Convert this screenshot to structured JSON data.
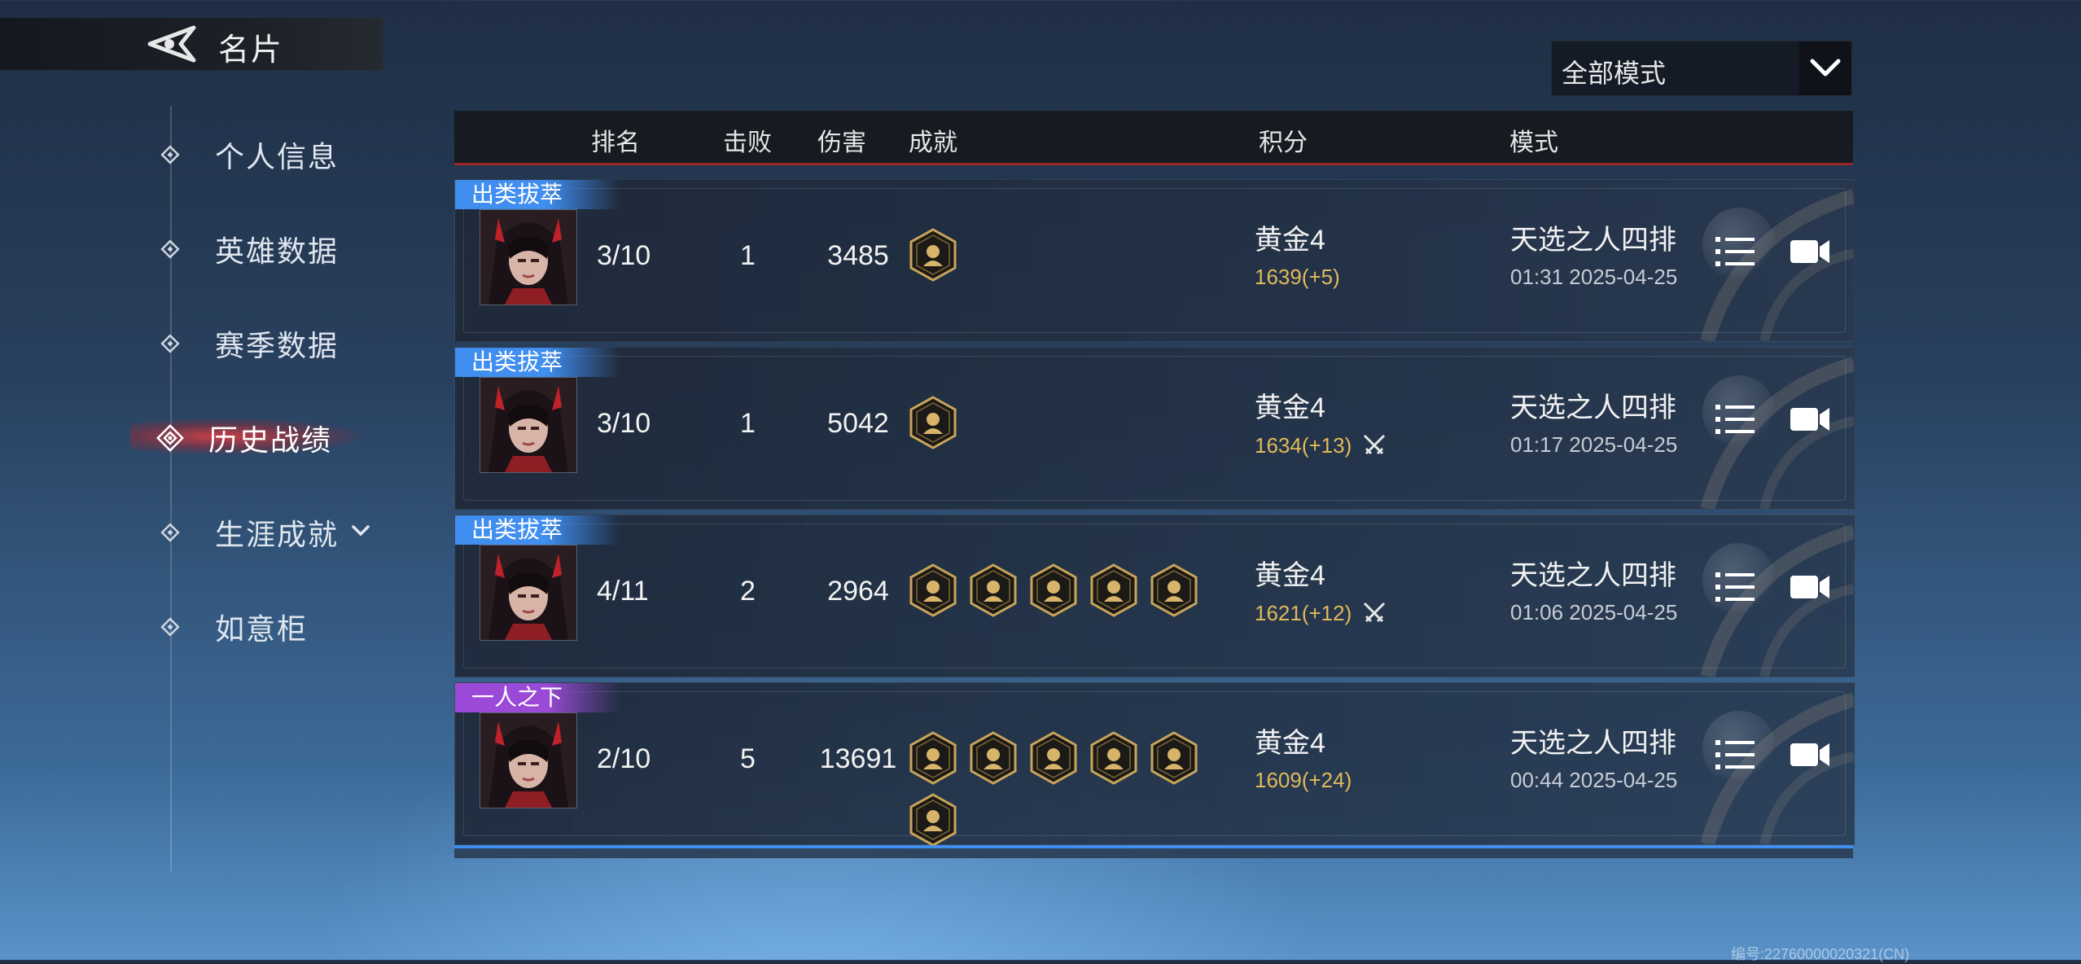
{
  "header": {
    "title": "名片",
    "back_icon": "back-arrow-icon"
  },
  "mode_filter": {
    "selected": "全部模式",
    "icon": "chevron-down-icon"
  },
  "sidebar": {
    "items": [
      {
        "label": "个人信息",
        "active": false
      },
      {
        "label": "英雄数据",
        "active": false
      },
      {
        "label": "赛季数据",
        "active": false
      },
      {
        "label": "历史战绩",
        "active": true
      },
      {
        "label": "生涯成就",
        "active": false,
        "expandable": true
      },
      {
        "label": "如意柜",
        "active": false
      }
    ]
  },
  "table": {
    "columns": [
      "排名",
      "击败",
      "伤害",
      "成就",
      "积分",
      "模式"
    ],
    "rows": [
      {
        "tag": "出类拔萃",
        "tag_color": "#3f8ef0",
        "rank": "3/10",
        "kills": "1",
        "damage": "3485",
        "medals": 1,
        "tier": "黄金4",
        "points": "1639(+5)",
        "swords": false,
        "mode": "天选之人四排",
        "time": "01:31  2025-04-25"
      },
      {
        "tag": "出类拔萃",
        "tag_color": "#3f8ef0",
        "rank": "3/10",
        "kills": "1",
        "damage": "5042",
        "medals": 1,
        "tier": "黄金4",
        "points": "1634(+13)",
        "swords": true,
        "mode": "天选之人四排",
        "time": "01:17  2025-04-25"
      },
      {
        "tag": "出类拔萃",
        "tag_color": "#3f8ef0",
        "rank": "4/11",
        "kills": "2",
        "damage": "2964",
        "medals": 5,
        "tier": "黄金4",
        "points": "1621(+12)",
        "swords": true,
        "mode": "天选之人四排",
        "time": "01:06  2025-04-25"
      },
      {
        "tag": "一人之下",
        "tag_color": "#9b4ad8",
        "rank": "2/10",
        "kills": "5",
        "damage": "13691",
        "medals": 6,
        "tier": "黄金4",
        "points": "1609(+24)",
        "swords": false,
        "mode": "天选之人四排",
        "time": "00:44  2025-04-25"
      }
    ]
  },
  "watermark": "编号:22760000020321(CN)",
  "colors": {
    "accent_red": "#9a2626",
    "gold": "#e2b95a",
    "tag_blue": "#3f8ef0",
    "tag_purple": "#9b4ad8"
  }
}
